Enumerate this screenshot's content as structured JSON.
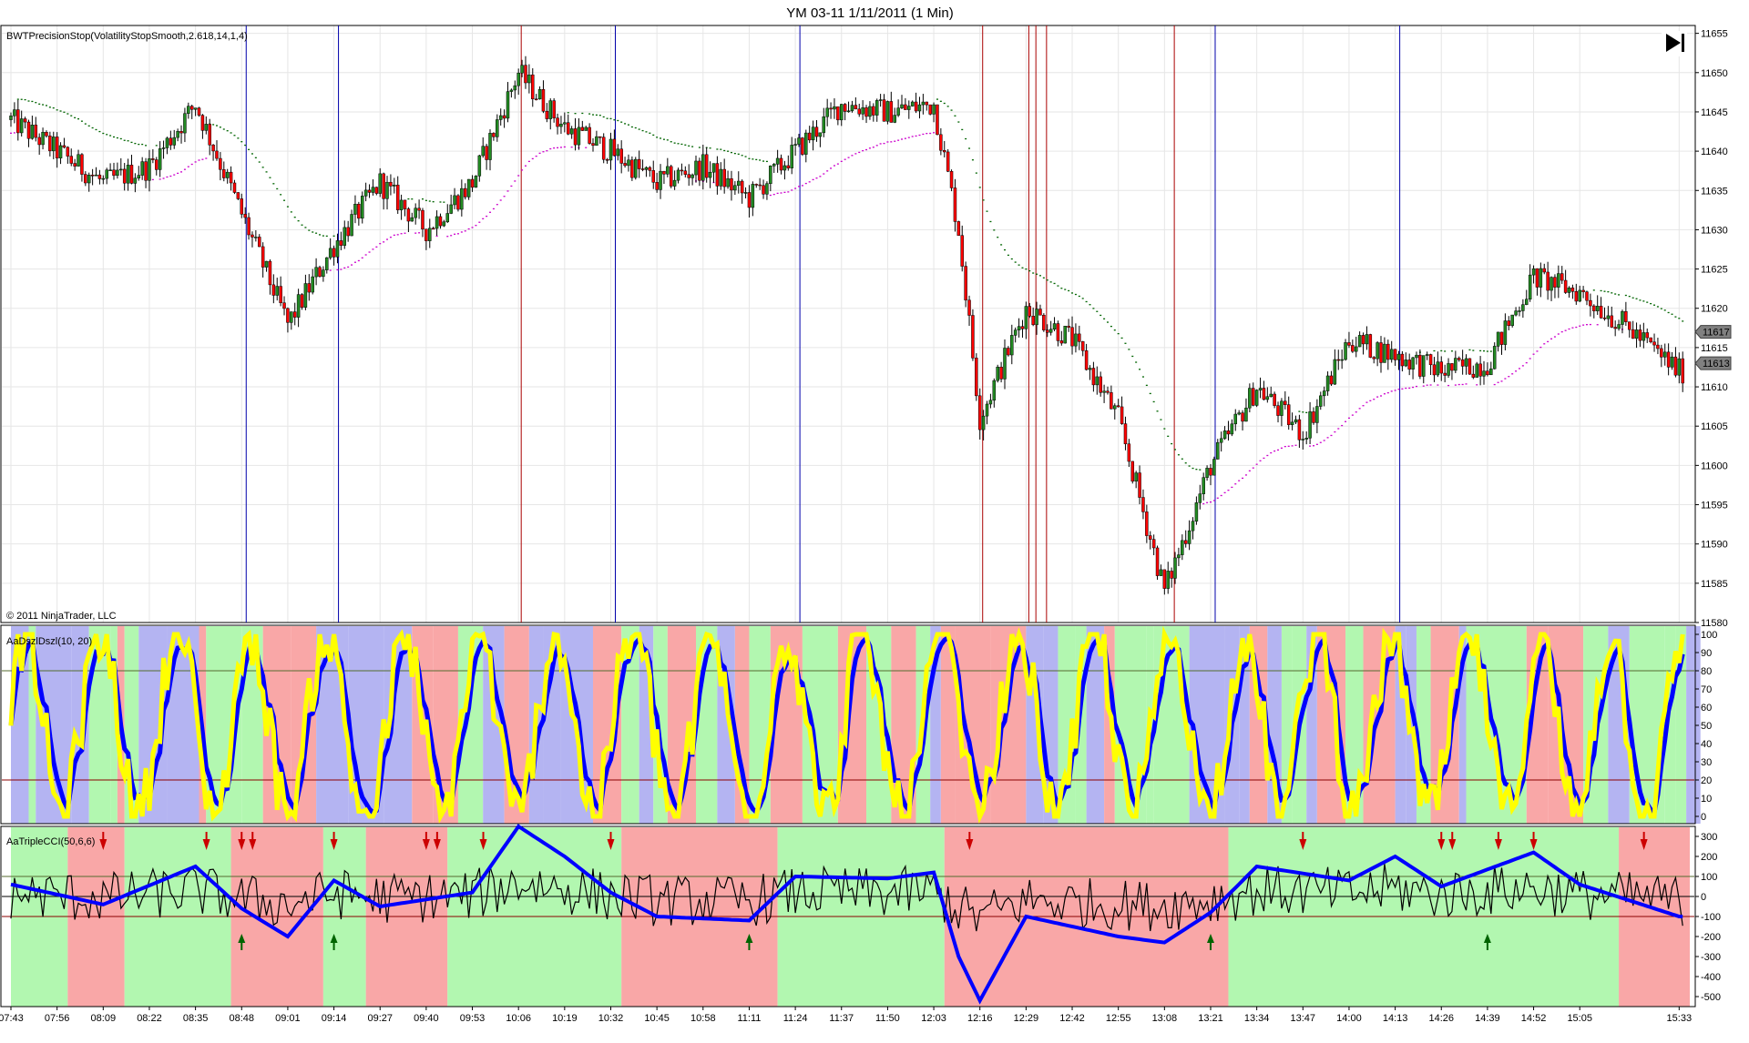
{
  "window": {
    "title": "YM 03-11  1/11/2011 (1 Min)",
    "play_button": "go-to-end"
  },
  "price_panel": {
    "indicator_label": "BWTPrecisionStop(VolatilityStopSmooth,2.618,14,1,4)",
    "copyright": "© 2011 NinjaTrader, LLC",
    "y_ticks": [
      "11655",
      "11650",
      "11645",
      "11640",
      "11635",
      "11630",
      "11625",
      "11620",
      "11615",
      "11610",
      "11605",
      "11600",
      "11595",
      "11590",
      "11585",
      "11580"
    ],
    "current_price_badges": [
      "11617",
      "11613"
    ]
  },
  "stoch_panel": {
    "indicator_label": "AaDszlDszl(10, 20)",
    "y_ticks": [
      "100",
      "90",
      "80",
      "70",
      "60",
      "50",
      "40",
      "30",
      "20",
      "10",
      "0"
    ]
  },
  "cci_panel": {
    "indicator_label": "AaTripleCCI(50,6,6)",
    "y_ticks": [
      "300",
      "200",
      "100",
      "0",
      "-100",
      "-200",
      "-300",
      "-400",
      "-500"
    ]
  },
  "x_axis": {
    "ticks": [
      "07:43",
      "07:56",
      "08:09",
      "08:22",
      "08:35",
      "08:48",
      "09:01",
      "09:14",
      "09:27",
      "09:40",
      "09:53",
      "10:06",
      "10:19",
      "10:32",
      "10:45",
      "10:58",
      "11:11",
      "11:24",
      "11:37",
      "11:50",
      "12:03",
      "12:16",
      "12:29",
      "12:42",
      "12:55",
      "13:08",
      "13:21",
      "13:34",
      "13:47",
      "14:00",
      "14:13",
      "14:26",
      "14:39",
      "14:52",
      "15:05",
      "15:33"
    ]
  },
  "colors": {
    "bull": "#228B22",
    "bear": "#FF0000",
    "stop_green": "#006400",
    "stop_magenta": "#CC00CC",
    "blue_line": "#0000FF",
    "yellow_line": "#FFFF00",
    "bg_green": "#B2F7B0",
    "bg_red": "#F9A7A7",
    "bg_blue": "#B4B4F2",
    "vline_blue": "#0000AA",
    "vline_red": "#AA0000"
  },
  "chart_data": {
    "type": "candlestick",
    "title": "YM 03-11  1/11/2011 (1 Min)",
    "x_start": "07:43",
    "x_end": "15:36",
    "ylim": [
      11580,
      11656
    ],
    "price_path": [
      {
        "t": "07:43",
        "p": 11644
      },
      {
        "t": "07:56",
        "p": 11640
      },
      {
        "t": "08:09",
        "p": 11636
      },
      {
        "t": "08:22",
        "p": 11638
      },
      {
        "t": "08:35",
        "p": 11646
      },
      {
        "t": "08:48",
        "p": 11632
      },
      {
        "t": "09:01",
        "p": 11618
      },
      {
        "t": "09:14",
        "p": 11628
      },
      {
        "t": "09:27",
        "p": 11636
      },
      {
        "t": "09:40",
        "p": 11630
      },
      {
        "t": "09:53",
        "p": 11636
      },
      {
        "t": "10:06",
        "p": 11650
      },
      {
        "t": "10:19",
        "p": 11643
      },
      {
        "t": "10:32",
        "p": 11640
      },
      {
        "t": "10:45",
        "p": 11636
      },
      {
        "t": "10:58",
        "p": 11638
      },
      {
        "t": "11:11",
        "p": 11634
      },
      {
        "t": "11:24",
        "p": 11640
      },
      {
        "t": "11:37",
        "p": 11646
      },
      {
        "t": "11:50",
        "p": 11645
      },
      {
        "t": "12:03",
        "p": 11646
      },
      {
        "t": "12:10",
        "p": 11630
      },
      {
        "t": "12:16",
        "p": 11606
      },
      {
        "t": "12:29",
        "p": 11620
      },
      {
        "t": "12:42",
        "p": 11616
      },
      {
        "t": "12:55",
        "p": 11606
      },
      {
        "t": "13:08",
        "p": 11584
      },
      {
        "t": "13:21",
        "p": 11600
      },
      {
        "t": "13:34",
        "p": 11610
      },
      {
        "t": "13:47",
        "p": 11604
      },
      {
        "t": "14:00",
        "p": 11616
      },
      {
        "t": "14:13",
        "p": 11614
      },
      {
        "t": "14:26",
        "p": 11612
      },
      {
        "t": "14:39",
        "p": 11613
      },
      {
        "t": "14:52",
        "p": 11624
      },
      {
        "t": "15:05",
        "p": 11622
      },
      {
        "t": "15:20",
        "p": 11617
      },
      {
        "t": "15:33",
        "p": 11612
      }
    ],
    "stoch": {
      "ylim": [
        0,
        100
      ],
      "levels": [
        80,
        20
      ]
    },
    "cci": {
      "ylim": [
        -550,
        350
      ],
      "levels": [
        100,
        0,
        -100
      ],
      "blue_path": [
        {
          "t": "07:43",
          "v": 60
        },
        {
          "t": "08:09",
          "v": -40
        },
        {
          "t": "08:35",
          "v": 150
        },
        {
          "t": "08:48",
          "v": -60
        },
        {
          "t": "09:01",
          "v": -200
        },
        {
          "t": "09:14",
          "v": 80
        },
        {
          "t": "09:27",
          "v": -50
        },
        {
          "t": "09:53",
          "v": 20
        },
        {
          "t": "10:06",
          "v": 350
        },
        {
          "t": "10:19",
          "v": 200
        },
        {
          "t": "10:32",
          "v": 20
        },
        {
          "t": "10:45",
          "v": -100
        },
        {
          "t": "11:11",
          "v": -120
        },
        {
          "t": "11:24",
          "v": 100
        },
        {
          "t": "11:50",
          "v": 90
        },
        {
          "t": "12:03",
          "v": 120
        },
        {
          "t": "12:10",
          "v": -300
        },
        {
          "t": "12:16",
          "v": -520
        },
        {
          "t": "12:29",
          "v": -100
        },
        {
          "t": "12:55",
          "v": -200
        },
        {
          "t": "13:08",
          "v": -230
        },
        {
          "t": "13:21",
          "v": -80
        },
        {
          "t": "13:34",
          "v": 150
        },
        {
          "t": "14:00",
          "v": 80
        },
        {
          "t": "14:13",
          "v": 200
        },
        {
          "t": "14:26",
          "v": 50
        },
        {
          "t": "14:52",
          "v": 220
        },
        {
          "t": "15:05",
          "v": 60
        },
        {
          "t": "15:33",
          "v": -100
        }
      ]
    }
  }
}
